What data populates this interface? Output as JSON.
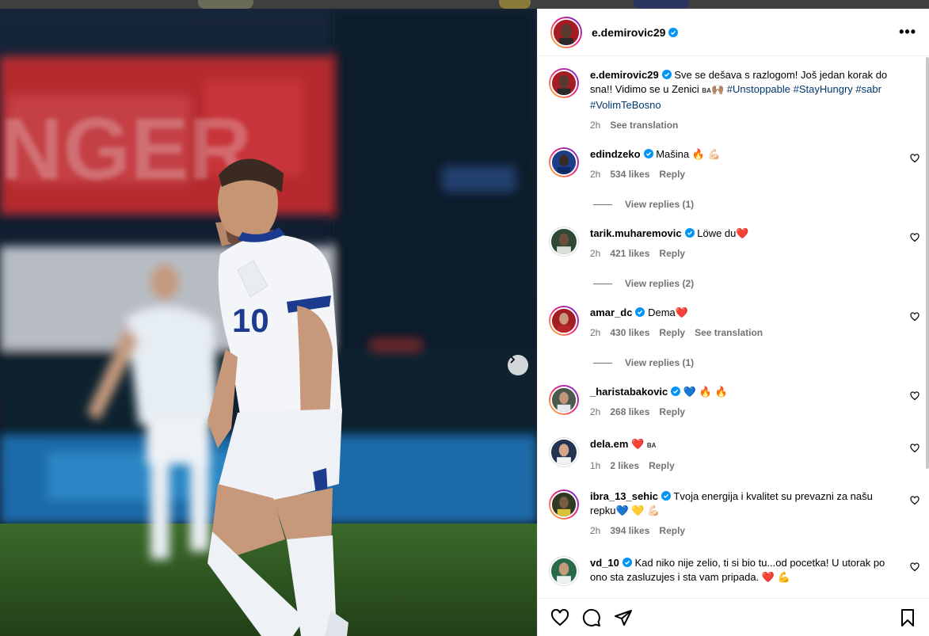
{
  "post": {
    "author": "e.demirovic29",
    "caption_text": "Sve se dešava s razlogom! Još jedan korak do sna!! Vidimo se u Zenici",
    "caption_flag": "BA",
    "caption_emoji": "🙌🏽",
    "hashtags": [
      "#Unstoppable",
      "#StayHungry",
      "#sabr",
      "#VolimTeBosno"
    ],
    "time": "2h",
    "see_translation": "See translation",
    "more_icon": "more-horizontal-icon",
    "jersey_number": "10"
  },
  "comments": [
    {
      "username": "edindzeko",
      "verified": true,
      "text": "Mašina",
      "emoji": "🔥 💪🏻",
      "time": "2h",
      "likes": "534 likes",
      "reply": "Reply",
      "view_replies": "View replies (1)",
      "avatar_color": "#1c3f8a"
    },
    {
      "username": "tarik.muharemovic",
      "verified": true,
      "text": "Löwe du",
      "emoji": "❤️",
      "time": "2h",
      "likes": "421 likes",
      "reply": "Reply",
      "view_replies": "View replies (2)",
      "avatar_color": "#2f4a33"
    },
    {
      "username": "amar_dc",
      "verified": true,
      "text": "Dema",
      "emoji": "❤️",
      "time": "2h",
      "likes": "430 likes",
      "reply": "Reply",
      "translation": "See translation",
      "view_replies": "View replies (1)",
      "avatar_color": "#a21e22"
    },
    {
      "username": "_haristabakovic",
      "verified": true,
      "text": "",
      "emoji": "💙 🔥 🔥",
      "time": "2h",
      "likes": "268 likes",
      "reply": "Reply",
      "avatar_color": "#4b5a4f"
    },
    {
      "username": "dela.em",
      "verified": false,
      "text": "",
      "emoji": "❤️",
      "flag": "BA",
      "time": "1h",
      "likes": "2 likes",
      "reply": "Reply",
      "avatar_color": "#22344f"
    },
    {
      "username": "ibra_13_sehic",
      "verified": true,
      "text": "Tvoja energija i kvalitet su prevazni za našu repku",
      "emoji": "💙 💛 💪🏻",
      "time": "2h",
      "likes": "394 likes",
      "reply": "Reply",
      "avatar_color": "#2e3a22"
    },
    {
      "username": "vd_10",
      "verified": true,
      "text": "Kad niko nije zelio, ti si bio tu...od pocetka! U utorak po ono sta zasluzujes i sta vam pripada.",
      "emoji": "❤️ 💪",
      "avatar_color": "#2a6a4c"
    }
  ],
  "actions": {
    "like_icon": "heart-icon",
    "comment_icon": "comment-icon",
    "share_icon": "share-icon",
    "save_icon": "bookmark-icon"
  },
  "colors": {
    "link": "#00376b",
    "meta": "#737373",
    "verified": "#0095f6"
  }
}
